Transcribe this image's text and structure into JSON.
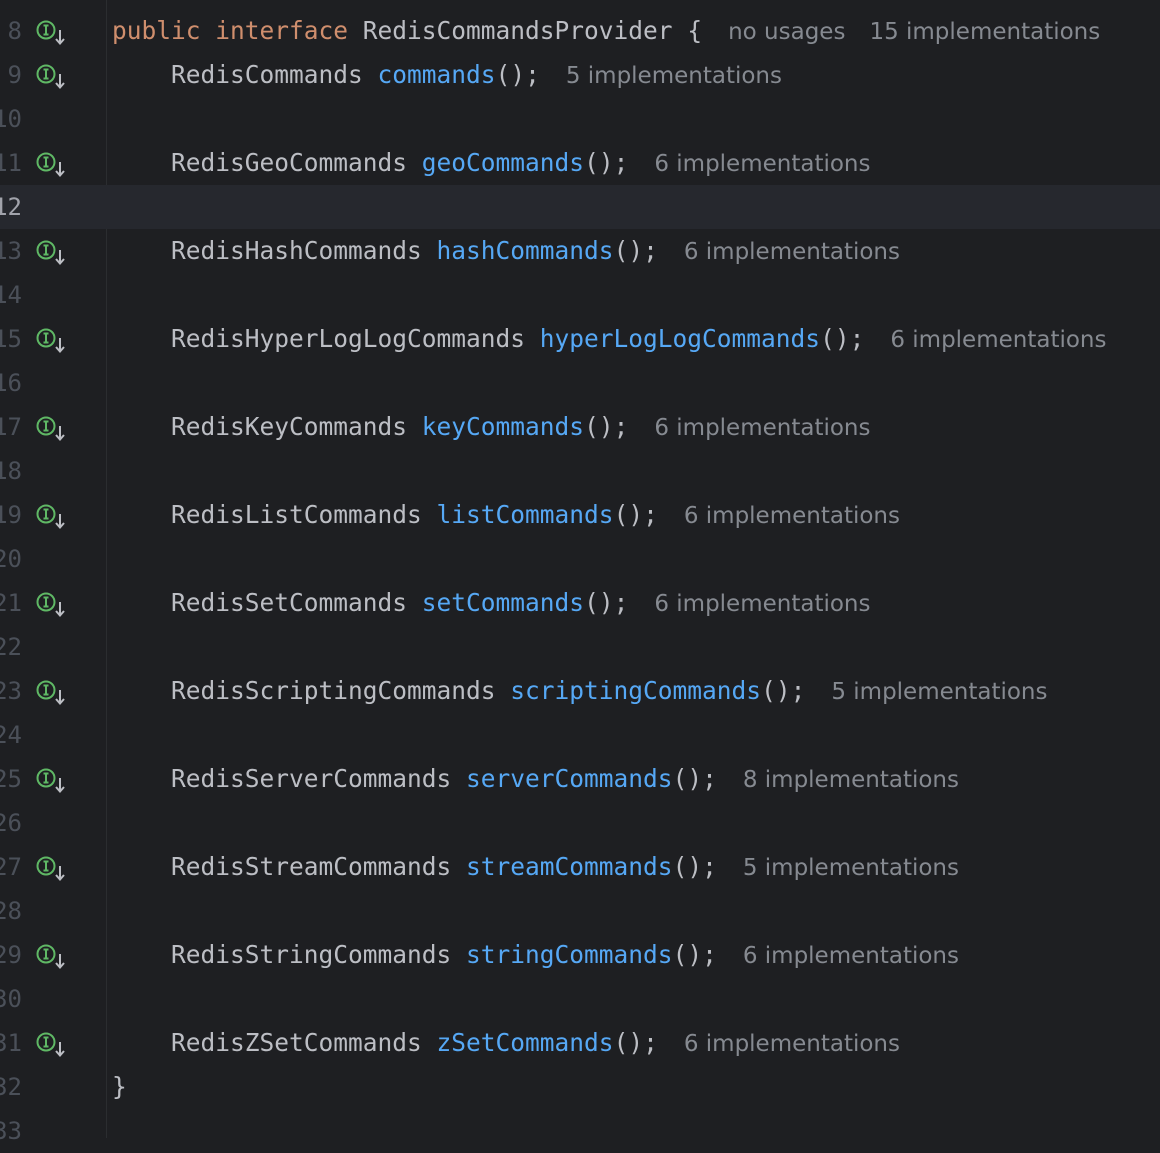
{
  "editor": {
    "current_line": 12,
    "lines": [
      {
        "number": "8",
        "icon": "implemented-interface-icon",
        "keywords": "public interface",
        "type": "RedisCommandsProvider",
        "brace": "{",
        "hint1": "no usages",
        "hint2": "15 implementations"
      },
      {
        "number": "9",
        "icon": "implemented-method-icon",
        "type": "RedisCommands",
        "method": "commands",
        "punct": "();",
        "hint": "5 implementations"
      },
      {
        "number": "10"
      },
      {
        "number": "11",
        "icon": "implemented-method-icon",
        "type": "RedisGeoCommands",
        "method": "geoCommands",
        "punct": "();",
        "hint": "6 implementations"
      },
      {
        "number": "12"
      },
      {
        "number": "13",
        "icon": "implemented-method-icon",
        "type": "RedisHashCommands",
        "method": "hashCommands",
        "punct": "();",
        "hint": "6 implementations"
      },
      {
        "number": "14"
      },
      {
        "number": "15",
        "icon": "implemented-method-icon",
        "type": "RedisHyperLogLogCommands",
        "method": "hyperLogLogCommands",
        "punct": "();",
        "hint": "6 implementations"
      },
      {
        "number": "16"
      },
      {
        "number": "17",
        "icon": "implemented-method-icon",
        "type": "RedisKeyCommands",
        "method": "keyCommands",
        "punct": "();",
        "hint": "6 implementations"
      },
      {
        "number": "18"
      },
      {
        "number": "19",
        "icon": "implemented-method-icon",
        "type": "RedisListCommands",
        "method": "listCommands",
        "punct": "();",
        "hint": "6 implementations"
      },
      {
        "number": "20"
      },
      {
        "number": "21",
        "icon": "implemented-method-icon",
        "type": "RedisSetCommands",
        "method": "setCommands",
        "punct": "();",
        "hint": "6 implementations"
      },
      {
        "number": "22"
      },
      {
        "number": "23",
        "icon": "implemented-method-icon",
        "type": "RedisScriptingCommands",
        "method": "scriptingCommands",
        "punct": "();",
        "hint": "5 implementations"
      },
      {
        "number": "24"
      },
      {
        "number": "25",
        "icon": "implemented-method-icon",
        "type": "RedisServerCommands",
        "method": "serverCommands",
        "punct": "();",
        "hint": "8 implementations"
      },
      {
        "number": "26"
      },
      {
        "number": "27",
        "icon": "implemented-method-icon",
        "type": "RedisStreamCommands",
        "method": "streamCommands",
        "punct": "();",
        "hint": "5 implementations"
      },
      {
        "number": "28"
      },
      {
        "number": "29",
        "icon": "implemented-method-icon",
        "type": "RedisStringCommands",
        "method": "stringCommands",
        "punct": "();",
        "hint": "6 implementations"
      },
      {
        "number": "30"
      },
      {
        "number": "31",
        "icon": "implemented-method-icon",
        "type": "RedisZSetCommands",
        "method": "zSetCommands",
        "punct": "();",
        "hint": "6 implementations"
      },
      {
        "number": "32",
        "closing": "}"
      },
      {
        "number": "33"
      }
    ]
  },
  "colors": {
    "background": "#1e1f22",
    "keyword": "#cf8e6d",
    "method": "#56a8f5",
    "text": "#bcbec4",
    "hint": "#868a91",
    "gutter_icon": "#5fb865",
    "current_line": "#26282e"
  }
}
